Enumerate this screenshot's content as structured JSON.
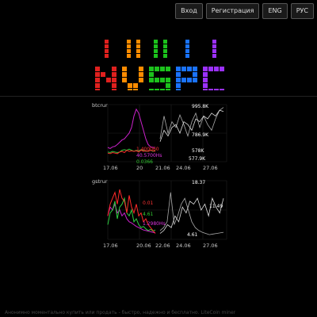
{
  "nav": {
    "login": "Вход",
    "register": "Регистрация",
    "eng": "ENG",
    "rus": "РУС"
  },
  "logo": {
    "text": "NVSPC",
    "colors": [
      "#e0201e",
      "#ff8c00",
      "#1cc21c",
      "#1a73ff",
      "#9b30ff"
    ]
  },
  "colors": {
    "green": "#2ecc40",
    "red": "#ff2a2a",
    "magenta": "#cc22cc",
    "gray": "#aaaaaa",
    "white": "#e0e0e0"
  },
  "chart_data": [
    {
      "type": "line",
      "ticker": "btcrur",
      "x_labels": [
        "17.06",
        "20",
        "21.06",
        "24.06",
        "27.06"
      ],
      "value_labels": [
        {
          "text": "995.8K",
          "color": "#ffffff"
        },
        {
          "text": "786.9K",
          "color": "#ffffff"
        },
        {
          "text": "578K",
          "color": "#ffffff"
        },
        {
          "text": "577.9K",
          "color": "#ffffff"
        },
        {
          "text": "1.400060",
          "color": "#ff3333"
        },
        {
          "text": "40.5700Hs",
          "color": "#dd33dd"
        },
        {
          "text": "0.0366",
          "color": "#33cc33"
        }
      ],
      "series": [
        {
          "color": "#cc22cc",
          "values": [
            0.75,
            0.77,
            0.74,
            0.73,
            0.7,
            0.66,
            0.62,
            0.6,
            0.55,
            0.5,
            0.4,
            0.2,
            0.08,
            0.15,
            0.3,
            0.45,
            0.6,
            0.7,
            0.74,
            0.75,
            0.75
          ]
        },
        {
          "color": "#2ecc40",
          "values": [
            0.83,
            0.84,
            0.82,
            0.83,
            0.84,
            0.83,
            0.8,
            0.79,
            0.8,
            0.78,
            0.8,
            0.82,
            0.8,
            0.81,
            0.79,
            0.8,
            0.82,
            0.81,
            0.8,
            0.82,
            0.8
          ]
        },
        {
          "color": "#ff2a2a",
          "values": [
            0.85,
            0.86,
            0.84,
            0.85,
            0.86,
            0.83,
            0.82,
            0.84,
            0.8,
            0.82,
            0.81,
            0.82,
            0.81,
            0.83,
            0.8,
            0.82,
            0.81,
            0.82,
            0.8,
            0.81,
            0.82
          ]
        },
        {
          "color": "#aaaaaa",
          "values": [
            0.6,
            0.2,
            0.5,
            0.3,
            0.4,
            0.18,
            0.35,
            0.55,
            0.3,
            0.15,
            0.4,
            0.2,
            0.35,
            0.45,
            0.25,
            0.1,
            0.05
          ]
        },
        {
          "color": "#dddddd",
          "values": [
            0.65,
            0.45,
            0.55,
            0.4,
            0.35,
            0.5,
            0.3,
            0.35,
            0.45,
            0.25,
            0.3,
            0.2,
            0.25,
            0.15,
            0.2,
            0.1,
            0.12
          ]
        }
      ]
    },
    {
      "type": "line",
      "ticker": "gstrur",
      "x_labels": [
        "17.06",
        "20.06",
        "22.06",
        "24.06",
        "27.06"
      ],
      "value_labels": [
        {
          "text": "18.37",
          "color": "#ffffff"
        },
        {
          "text": "11.49",
          "color": "#ffffff"
        },
        {
          "text": "4.61",
          "color": "#ffffff"
        },
        {
          "text": "0.01",
          "color": "#ff3333"
        },
        {
          "text": "4.61",
          "color": "#33cc33"
        },
        {
          "text": "1.2980Hs",
          "color": "#dd33dd"
        }
      ],
      "series": [
        {
          "color": "#cc22cc",
          "values": [
            0.6,
            0.45,
            0.5,
            0.4,
            0.55,
            0.5,
            0.6,
            0.55,
            0.65,
            0.7,
            0.72,
            0.75,
            0.78,
            0.8,
            0.82,
            0.84,
            0.85,
            0.86,
            0.87,
            0.88,
            0.89
          ]
        },
        {
          "color": "#2ecc40",
          "values": [
            0.75,
            0.55,
            0.5,
            0.35,
            0.65,
            0.45,
            0.4,
            0.3,
            0.55,
            0.6,
            0.5,
            0.7,
            0.65,
            0.75,
            0.8,
            0.78,
            0.82,
            0.85,
            0.83,
            0.86,
            0.84
          ]
        },
        {
          "color": "#ff2a2a",
          "values": [
            0.6,
            0.4,
            0.3,
            0.2,
            0.4,
            0.15,
            0.3,
            0.35,
            0.55,
            0.25,
            0.45,
            0.55,
            0.4,
            0.6,
            0.55,
            0.7,
            0.65,
            0.75,
            0.8,
            0.85,
            0.9
          ]
        },
        {
          "color": "#aaaaaa",
          "values": [
            0.85,
            0.8,
            0.7,
            0.2,
            0.75,
            0.6,
            0.4,
            0.3,
            0.5,
            0.7,
            0.8,
            0.85,
            0.88,
            0.9,
            0.92,
            0.91,
            0.9,
            0.89,
            0.88
          ]
        },
        {
          "color": "#dddddd",
          "values": [
            0.9,
            0.85,
            0.75,
            0.8,
            0.6,
            0.7,
            0.45,
            0.55,
            0.35,
            0.4,
            0.3,
            0.5,
            0.4,
            0.6,
            0.3,
            0.45,
            0.55,
            0.3
          ]
        }
      ]
    }
  ],
  "footer": {
    "text": "Анонимно моментально купить или продать - быстро, надежно и бесплатно. LiteCoin miner"
  }
}
